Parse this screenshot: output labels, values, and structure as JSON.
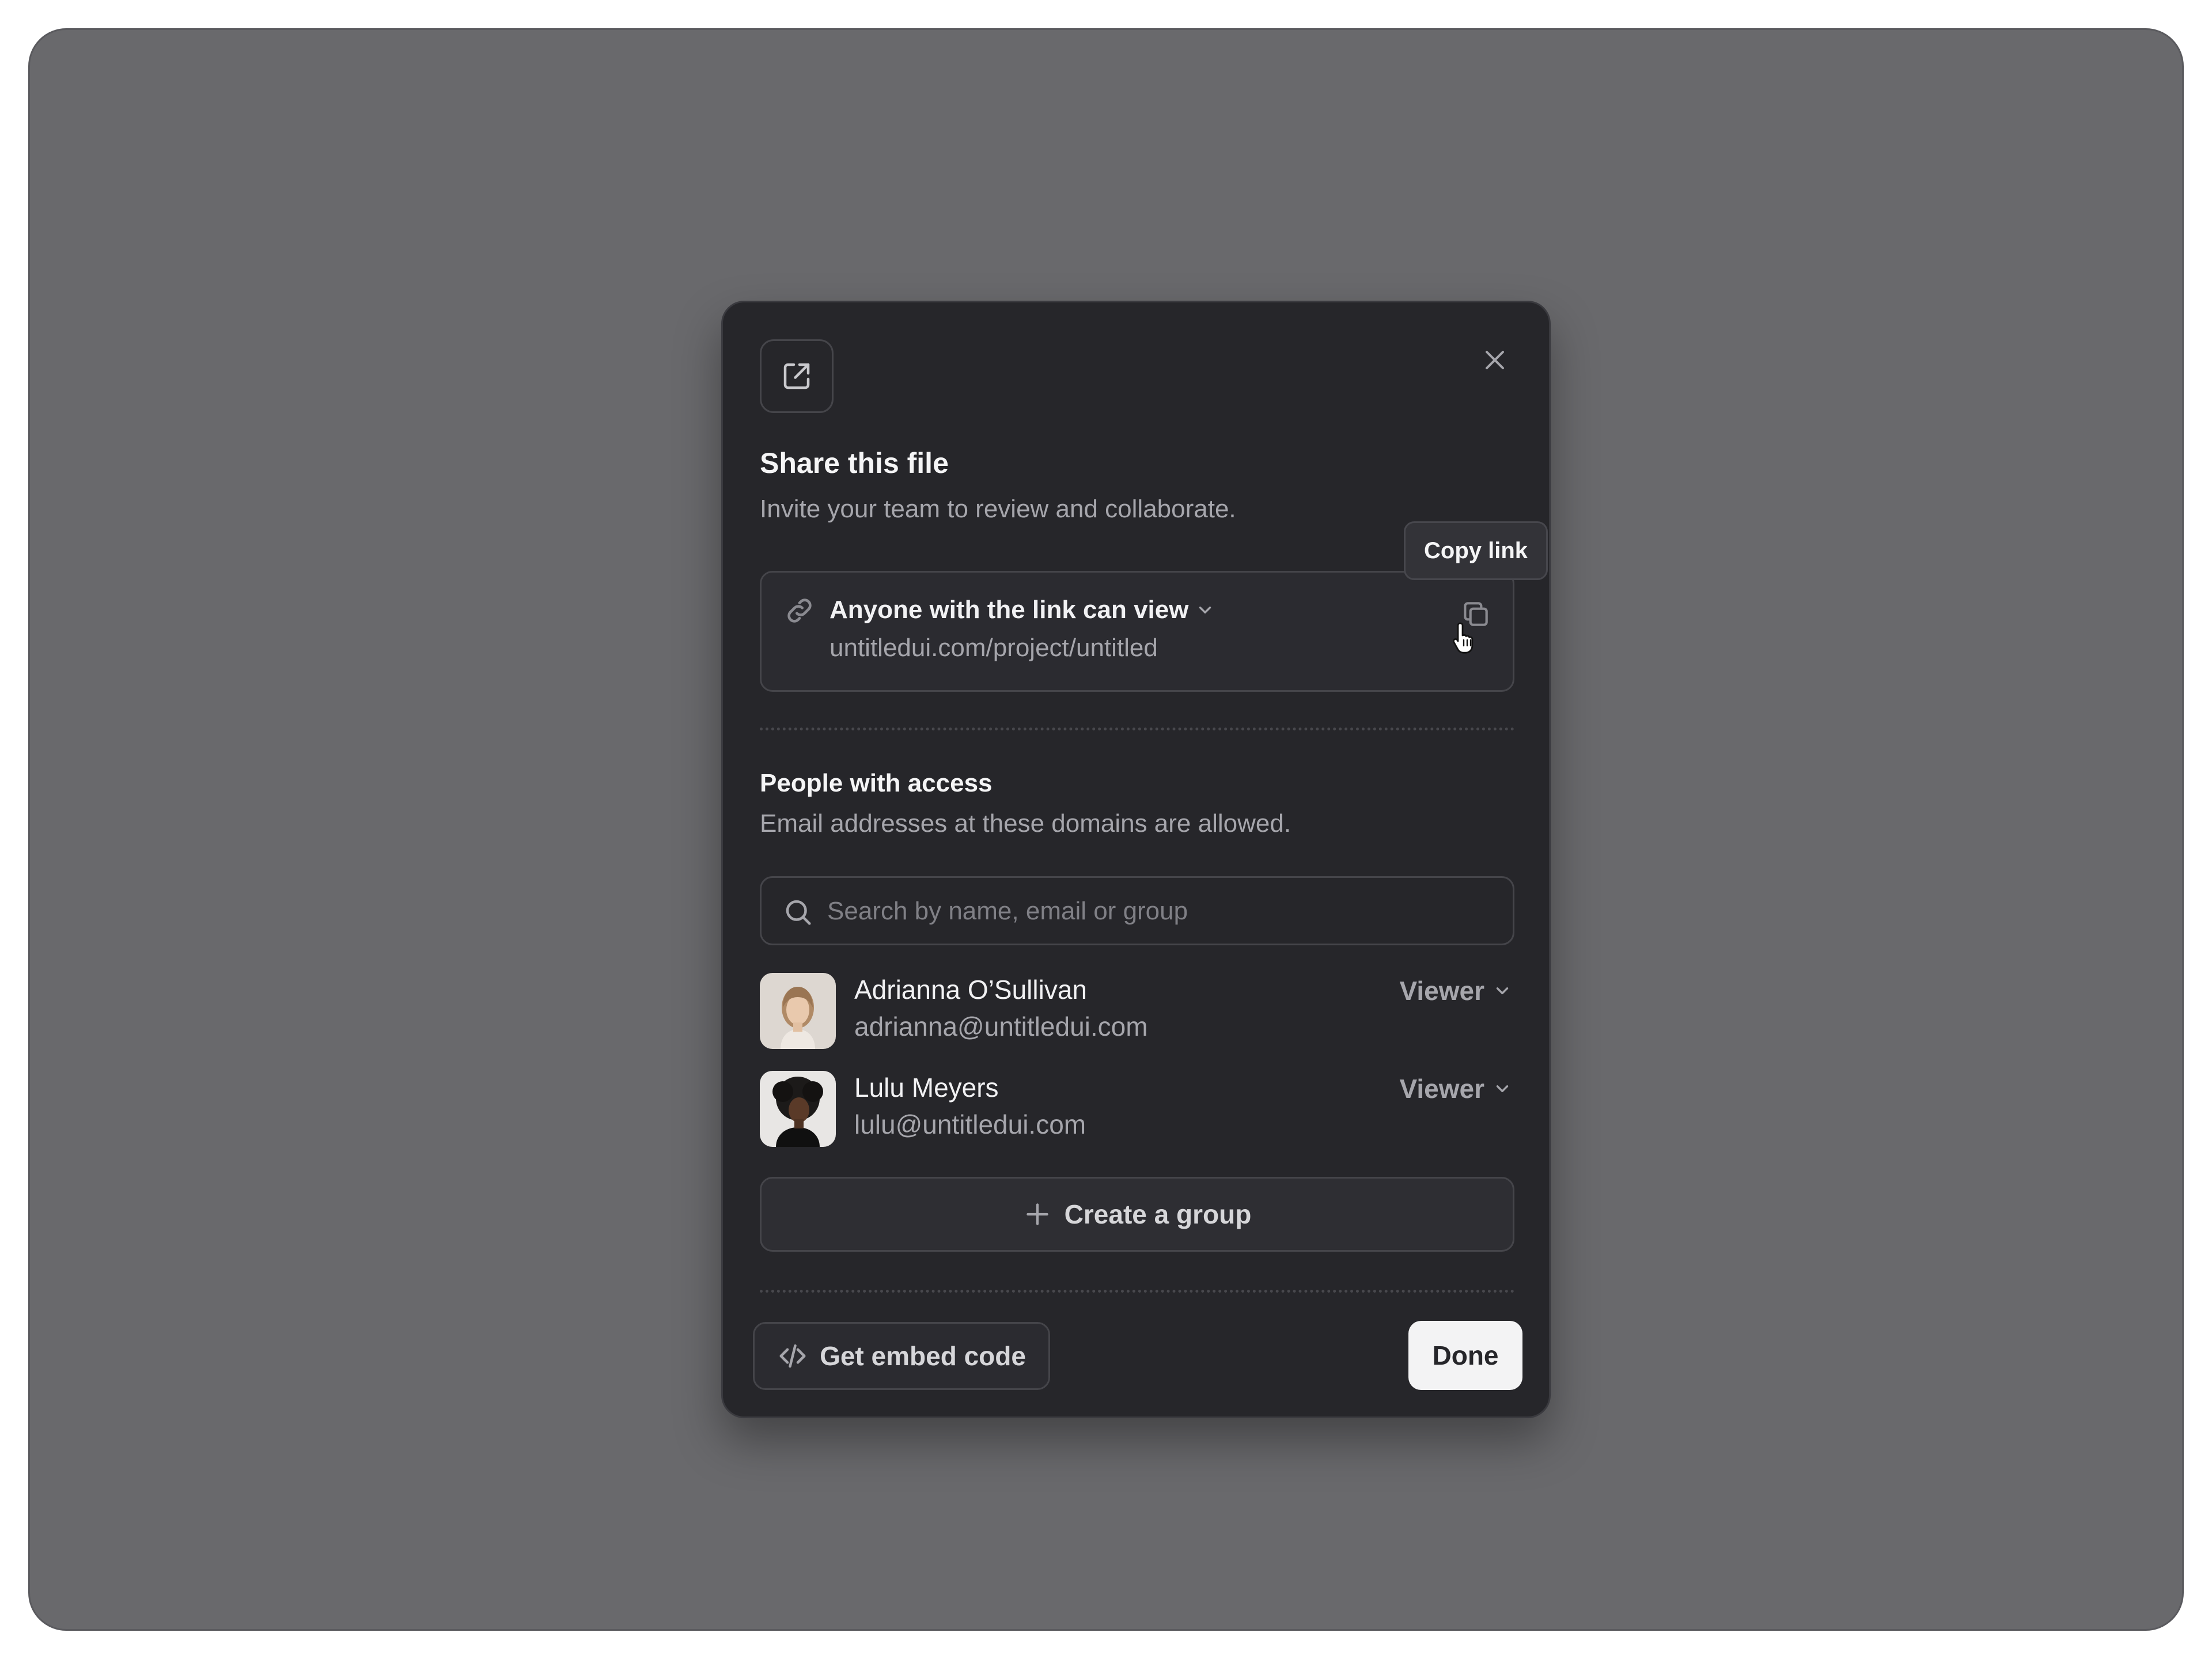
{
  "dialog": {
    "title": "Share this file",
    "subtitle": "Invite your team to review and collaborate.",
    "header_icon": "share-external-icon",
    "close_icon": "close-icon"
  },
  "link": {
    "access_label": "Anyone with the link can view",
    "url": "untitledui.com/project/untitled",
    "copy_tooltip": "Copy link"
  },
  "access": {
    "title": "People with access",
    "subtitle": "Email addresses at these domains are allowed.",
    "search_placeholder": "Search by name, email or group",
    "people": [
      {
        "name": "Adrianna O’Sullivan",
        "email": "adrianna@untitledui.com",
        "role": "Viewer"
      },
      {
        "name": "Lulu Meyers",
        "email": "lulu@untitledui.com",
        "role": "Viewer"
      }
    ],
    "create_group_label": "Create a group"
  },
  "footer": {
    "embed_label": "Get embed code",
    "done_label": "Done"
  },
  "colors": {
    "backdrop": "#69696c",
    "modal_bg": "#26262a",
    "text_primary": "#f5f5f6",
    "text_secondary": "#a6a6ac",
    "button_light": "#f3f3f4"
  }
}
